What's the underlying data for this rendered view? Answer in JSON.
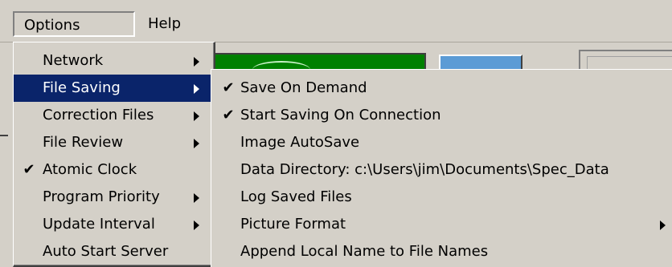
{
  "menubar": {
    "options_label": "Options",
    "help_label": "Help"
  },
  "options_menu": {
    "items": [
      {
        "label": "Network",
        "checked": false,
        "has_submenu": true,
        "highlighted": false
      },
      {
        "label": "File Saving",
        "checked": false,
        "has_submenu": true,
        "highlighted": true
      },
      {
        "label": "Correction Files",
        "checked": false,
        "has_submenu": true,
        "highlighted": false
      },
      {
        "label": "File Review",
        "checked": false,
        "has_submenu": true,
        "highlighted": false
      },
      {
        "label": "Atomic Clock",
        "checked": true,
        "has_submenu": false,
        "highlighted": false
      },
      {
        "label": "Program Priority",
        "checked": false,
        "has_submenu": true,
        "highlighted": false
      },
      {
        "label": "Update Interval",
        "checked": false,
        "has_submenu": true,
        "highlighted": false
      },
      {
        "label": "Auto Start Server",
        "checked": false,
        "has_submenu": false,
        "highlighted": false
      }
    ]
  },
  "file_saving_submenu": {
    "items": [
      {
        "label": "Save On Demand",
        "checked": true,
        "has_submenu": false
      },
      {
        "label": "Start Saving On Connection",
        "checked": true,
        "has_submenu": false
      },
      {
        "label": "Image AutoSave",
        "checked": false,
        "has_submenu": false
      },
      {
        "label": "Data Directory: c:\\Users\\jim\\Documents\\Spec_Data",
        "checked": false,
        "has_submenu": false
      },
      {
        "label": "Log Saved Files",
        "checked": false,
        "has_submenu": false
      },
      {
        "label": "Picture Format",
        "checked": false,
        "has_submenu": true
      },
      {
        "label": "Append Local Name to File Names",
        "checked": false,
        "has_submenu": false
      }
    ]
  },
  "glyphs": {
    "check": "✔"
  },
  "colors": {
    "menu_bg": "#d4d0c8",
    "highlight_bg": "#0a246a",
    "highlight_text": "#ffffff",
    "bg_green": "#008000",
    "bg_button_blue": "#5b9bd5"
  }
}
